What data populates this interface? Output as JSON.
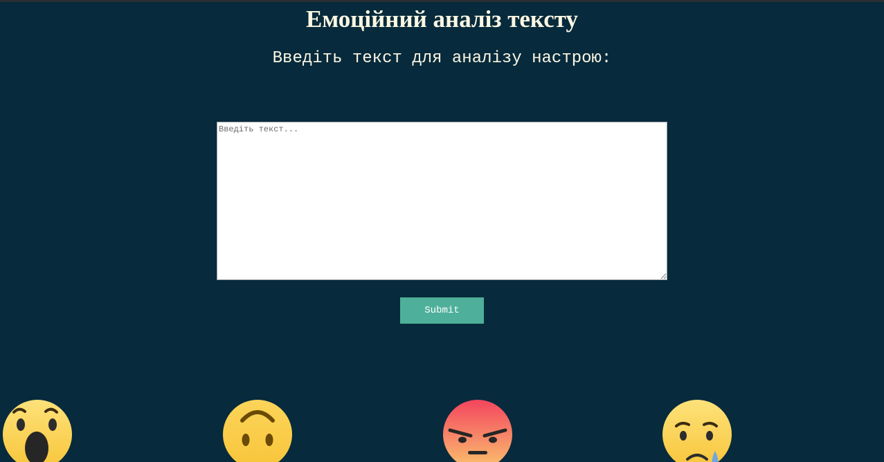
{
  "header": {
    "title": "Емоційний аналіз тексту",
    "subtitle": "Введіть текст для аналізу настрою:"
  },
  "form": {
    "textarea_placeholder": "Введіть текст...",
    "submit_label": "Submit"
  },
  "emojis": [
    {
      "name": "wow-emoji-icon"
    },
    {
      "name": "upside-down-face-emoji-icon"
    },
    {
      "name": "angry-emoji-icon"
    },
    {
      "name": "sad-tear-emoji-icon"
    }
  ],
  "colors": {
    "background": "#072a3c",
    "text": "#fbf7e3",
    "button": "#4eb09a",
    "emoji_yellow": "#fcd55e"
  }
}
